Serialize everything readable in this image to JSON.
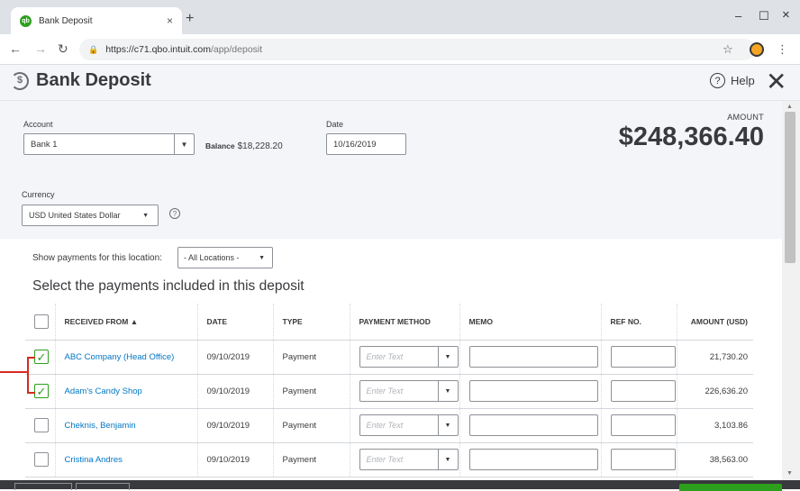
{
  "browser": {
    "tab_title": "Bank Deposit",
    "tab_close": "×",
    "new_tab": "+",
    "url_host": "https://c71.qbo.intuit.com",
    "url_path": "/app/deposit",
    "minimize": "–",
    "maximize": "☐",
    "close": "×"
  },
  "header": {
    "title": "Bank Deposit",
    "help_label": "Help"
  },
  "form": {
    "account_label": "Account",
    "account_value": "Bank 1",
    "balance_label": "Balance",
    "balance_value": "$18,228.20",
    "date_label": "Date",
    "date_value": "10/16/2019",
    "amount_label": "AMOUNT",
    "amount_value": "$248,366.40",
    "currency_label": "Currency",
    "currency_value": "USD United States Dollar"
  },
  "payments": {
    "location_label": "Show payments for this location:",
    "location_value": "- All Locations -",
    "section_title": "Select the payments included in this deposit",
    "columns": {
      "received_from": "RECEIVED FROM ▲",
      "date": "DATE",
      "type": "TYPE",
      "payment_method": "PAYMENT METHOD",
      "memo": "MEMO",
      "ref_no": "REF NO.",
      "amount": "AMOUNT (USD)"
    },
    "placeholder": "Enter Text",
    "rows": [
      {
        "checked": true,
        "received_from": "ABC Company (Head Office)",
        "date": "09/10/2019",
        "type": "Payment",
        "amount": "21,730.20"
      },
      {
        "checked": true,
        "received_from": "Adam's Candy Shop",
        "date": "09/10/2019",
        "type": "Payment",
        "amount": "226,636.20"
      },
      {
        "checked": false,
        "received_from": "Cheknis, Benjamin",
        "date": "09/10/2019",
        "type": "Payment",
        "amount": "3,103.86"
      },
      {
        "checked": false,
        "received_from": "Cristina Andres",
        "date": "09/10/2019",
        "type": "Payment",
        "amount": "38,563.00"
      }
    ]
  },
  "colors": {
    "accent_green": "#2ca01c",
    "link_blue": "#0077c5",
    "annotation_red": "#d52b1e"
  }
}
